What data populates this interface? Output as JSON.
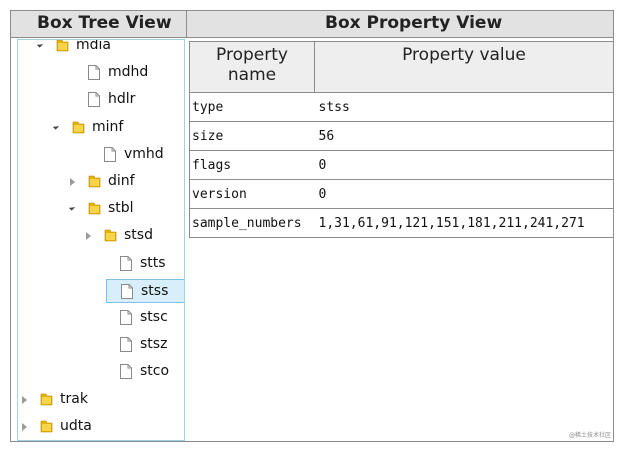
{
  "headers": {
    "tree_title": "Box Tree View",
    "property_title": "Box Property View"
  },
  "tree": {
    "nodes": [
      {
        "label": "mdia",
        "type": "folder",
        "expander": "open"
      },
      {
        "label": "mdhd",
        "type": "file",
        "expander": "none"
      },
      {
        "label": "hdlr",
        "type": "file",
        "expander": "none"
      },
      {
        "label": "minf",
        "type": "folder",
        "expander": "open"
      },
      {
        "label": "vmhd",
        "type": "file",
        "expander": "none"
      },
      {
        "label": "dinf",
        "type": "folder",
        "expander": "closed"
      },
      {
        "label": "stbl",
        "type": "folder",
        "expander": "open"
      },
      {
        "label": "stsd",
        "type": "folder",
        "expander": "closed"
      },
      {
        "label": "stts",
        "type": "file",
        "expander": "none"
      },
      {
        "label": "stss",
        "type": "file",
        "expander": "none",
        "selected": true
      },
      {
        "label": "stsc",
        "type": "file",
        "expander": "none"
      },
      {
        "label": "stsz",
        "type": "file",
        "expander": "none"
      },
      {
        "label": "stco",
        "type": "file",
        "expander": "none"
      },
      {
        "label": "trak",
        "type": "folder",
        "expander": "closed"
      },
      {
        "label": "udta",
        "type": "folder",
        "expander": "closed"
      }
    ]
  },
  "properties": {
    "column_headers": [
      "Property name",
      "Property value"
    ],
    "rows": [
      {
        "name": "type",
        "value": "stss"
      },
      {
        "name": "size",
        "value": "56"
      },
      {
        "name": "flags",
        "value": "0"
      },
      {
        "name": "version",
        "value": "0"
      },
      {
        "name": "sample_numbers",
        "value": "1,31,61,91,121,151,181,211,241,271"
      }
    ]
  },
  "watermark": "@稀土技术社区",
  "colors": {
    "folder": "#e6b400",
    "selection": "#d9eefb",
    "selection_border": "#7fbfe6",
    "tree_border": "#9fd1ec"
  }
}
